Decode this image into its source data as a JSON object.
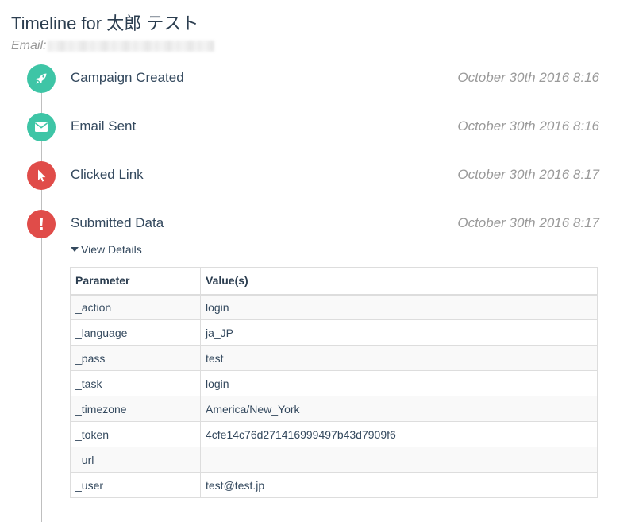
{
  "header": {
    "title": "Timeline for 太郎 テスト",
    "email_label": "Email:"
  },
  "events": [
    {
      "label": "Campaign Created",
      "time": "October 30th 2016 8:16",
      "icon": "rocket-icon",
      "color": "#3ec5a6"
    },
    {
      "label": "Email Sent",
      "time": "October 30th 2016 8:16",
      "icon": "envelope-icon",
      "color": "#3ec5a6"
    },
    {
      "label": "Clicked Link",
      "time": "October 30th 2016 8:17",
      "icon": "mouse-pointer-icon",
      "color": "#e04c49"
    },
    {
      "label": "Submitted Data",
      "time": "October 30th 2016 8:17",
      "icon": "exclamation-icon",
      "color": "#e04c49"
    }
  ],
  "details": {
    "toggle_label": "View Details",
    "columns": [
      "Parameter",
      "Value(s)"
    ],
    "rows": [
      [
        "_action",
        "login"
      ],
      [
        "_language",
        "ja_JP"
      ],
      [
        "_pass",
        "test"
      ],
      [
        "_task",
        "login"
      ],
      [
        "_timezone",
        "America/New_York"
      ],
      [
        "_token",
        "4cfe14c76d271416999497b43d7909f6"
      ],
      [
        "_url",
        ""
      ],
      [
        "_user",
        "test@test.jp"
      ]
    ]
  }
}
